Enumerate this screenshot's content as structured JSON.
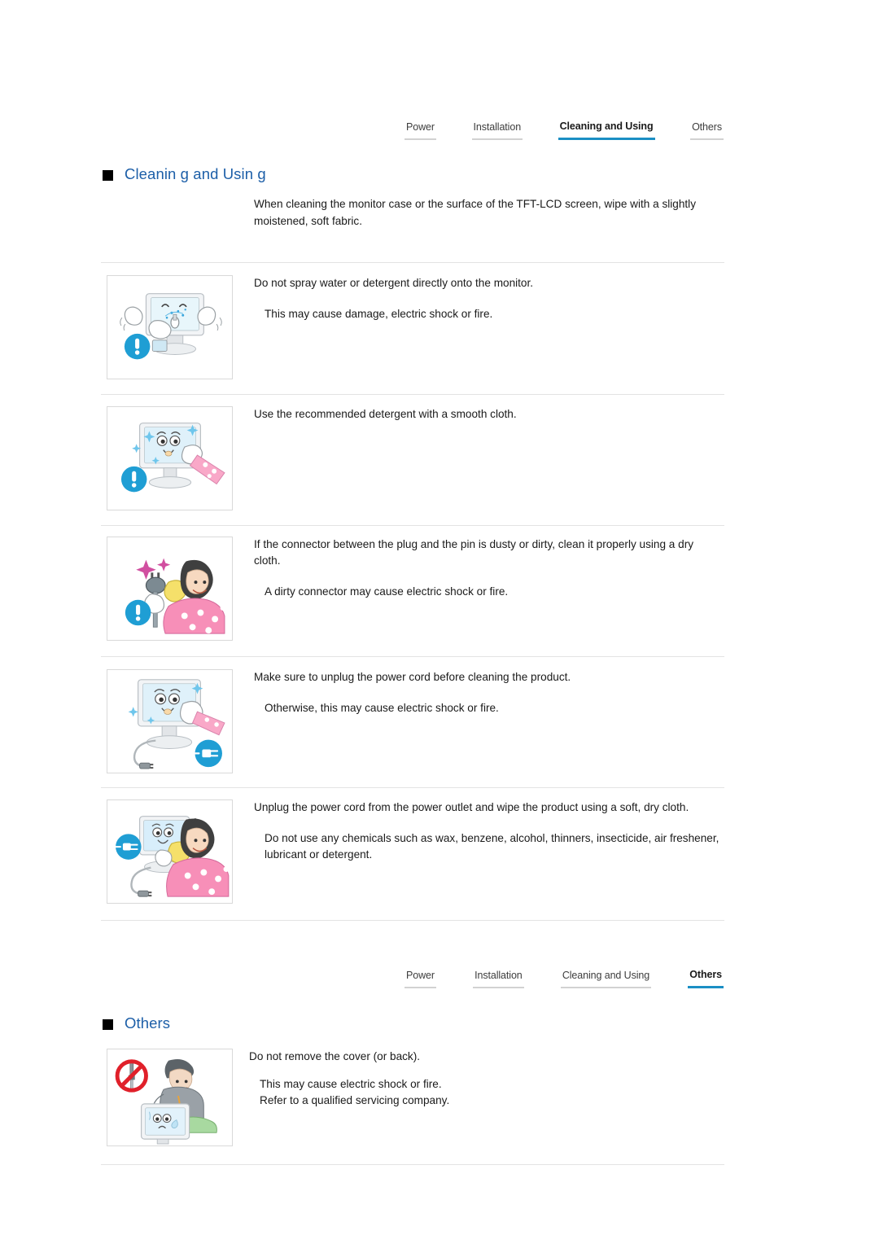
{
  "nav_primary": {
    "tabs": [
      {
        "label": "Power",
        "active": false
      },
      {
        "label": "Installation",
        "active": false
      },
      {
        "label": "Cleaning and Using",
        "active": true
      },
      {
        "label": "Others",
        "active": false
      }
    ]
  },
  "nav_secondary": {
    "tabs": [
      {
        "label": "Power",
        "active": false
      },
      {
        "label": "Installation",
        "active": false
      },
      {
        "label": "Cleaning and Using",
        "active": false
      },
      {
        "label": "Others",
        "active": true
      }
    ]
  },
  "cleaning_section": {
    "title": "Cleanin g and Usin g",
    "intro": "When cleaning the monitor case or the surface of the TFT-LCD screen, wipe with a slightly moistened, soft fabric.",
    "items": [
      {
        "figure": "monitor-spray-bottle-warning",
        "lead": "Do not spray water or detergent directly onto the monitor.",
        "sub": "This may cause damage, electric shock or fire."
      },
      {
        "figure": "monitor-wipe-cloth-warning",
        "lead": "Use the recommended detergent with a smooth cloth.",
        "sub": ""
      },
      {
        "figure": "woman-cleaning-plug-warning",
        "lead": "If the connector between the plug and the pin is dusty or dirty, clean it properly using a dry cloth.",
        "sub": "A dirty connector may cause electric shock or fire."
      },
      {
        "figure": "monitor-unplug-wipe",
        "lead": "Make sure to unplug the power cord before cleaning the product.",
        "sub": "Otherwise, this may cause electric shock or fire."
      },
      {
        "figure": "woman-unplug-wipe-monitor",
        "lead": "Unplug the power cord from the power outlet and wipe the product using a soft, dry cloth.",
        "sub": "Do not use any chemicals such as wax, benzene, alcohol, thinners, insecticide, air freshener, lubricant or detergent."
      }
    ]
  },
  "others_section": {
    "title": "Others",
    "items": [
      {
        "figure": "no-disassembly-repairman",
        "lead": "Do not remove the cover (or back).",
        "sub": "This may cause electric shock or fire.\nRefer to a qualified servicing company."
      }
    ]
  },
  "colors": {
    "heading_blue": "#1d5fa8",
    "tab_active_underline": "#1b8fc4",
    "tab_inactive_underline": "#d2d2d2",
    "rule": "#e3e3e3",
    "warning_icon_blue": "#1f9ed4",
    "prohibition_red": "#e0202a"
  }
}
